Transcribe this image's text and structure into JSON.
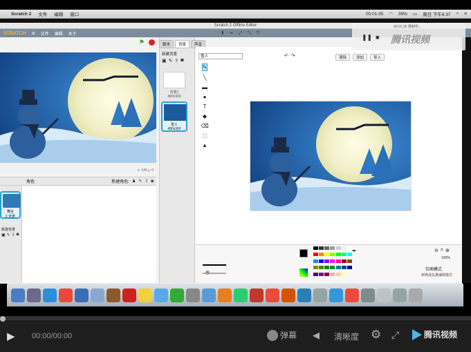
{
  "menubar": {
    "app": "Scratch 2",
    "items": [
      "文件",
      "编辑",
      "窗口"
    ],
    "time": "00:01:35",
    "battery": "39%",
    "clock": "周日 下午6:37"
  },
  "window": {
    "title": "Scratch 2 Offline Editor"
  },
  "scratch": {
    "menu": [
      "文件",
      "编辑",
      "关于"
    ]
  },
  "stage": {
    "coords": "x: 146  y: 0"
  },
  "sprites": {
    "header": "角色",
    "new_label": "新建角色:",
    "thumb_name": "舞台",
    "thumb_sub": "2 背景",
    "backdrop_label": "新建背景"
  },
  "tabs": [
    "脚本",
    "背景",
    "声音"
  ],
  "backdrops": {
    "new_label": "新建背景",
    "bd1_name": "背景1",
    "bd1_size": "480x360",
    "bd2_name": "雪人",
    "bd2_size": "480x360"
  },
  "paint": {
    "name_placeholder": "雪人",
    "actions": [
      "清除",
      "添加",
      "导入"
    ],
    "zoom": "100%",
    "mode_label": "位图模式",
    "mode_button": "转换成矢量编辑模式"
  },
  "overlay": {
    "time": "00:01:35 录制中..."
  },
  "player": {
    "time": "00:00/00:00",
    "danmu": "弹幕",
    "clarity": "清晰度",
    "brand": "腾讯视频"
  },
  "colors": {
    "accent": "#25a0d8",
    "stop": "#e02020",
    "sky": "#1c5a99"
  }
}
